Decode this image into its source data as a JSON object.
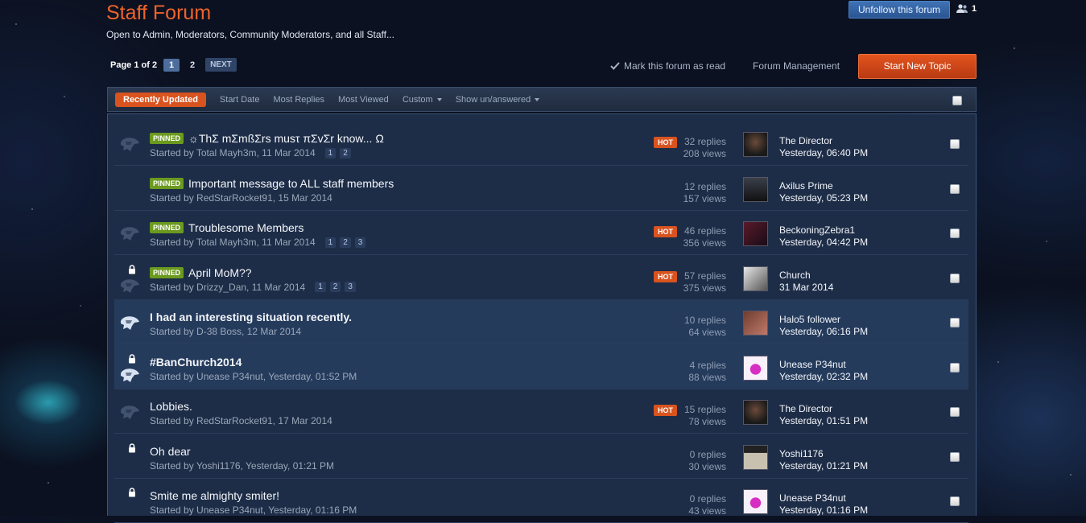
{
  "header": {
    "title": "Staff Forum",
    "subtitle": "Open to Admin, Moderators, Community Moderators, and all Staff...",
    "unfollow_label": "Unfollow this forum",
    "followers_count": "1"
  },
  "pagination": {
    "page_info": "Page 1 of 2",
    "pages": [
      "1",
      "2"
    ],
    "next_label": "NEXT"
  },
  "actions": {
    "mark_read": "Mark this forum as read",
    "forum_management": "Forum Management",
    "start_topic": "Start New Topic"
  },
  "filters": {
    "active": "Recently Updated",
    "items": [
      "Start Date",
      "Most Replies",
      "Most Viewed",
      "Custom",
      "Show un/answered"
    ]
  },
  "badges": {
    "pinned": "PINNED",
    "hot": "HOT"
  },
  "topics": [
    {
      "pinned": true,
      "hot": true,
      "title": "☼ThΣ mΣmßΣrs musτ πΣvΣr know... Ω",
      "started": "Started by Total Mayh3m, 11 Mar 2014",
      "pages": [
        "1",
        "2"
      ],
      "replies": "32 replies",
      "views": "208 views",
      "last_user": "The Director",
      "last_date": "Yesterday, 06:40 PM"
    },
    {
      "pinned": true,
      "hot": false,
      "title": "Important message to ALL staff members",
      "started": "Started by RedStarRocket91, 15 Mar 2014",
      "pages": [],
      "replies": "12 replies",
      "views": "157 views",
      "last_user": "Axilus Prime",
      "last_date": "Yesterday, 05:23 PM"
    },
    {
      "pinned": true,
      "hot": true,
      "title": "Troublesome Members",
      "started": "Started by Total Mayh3m, 11 Mar 2014",
      "pages": [
        "1",
        "2",
        "3"
      ],
      "replies": "46 replies",
      "views": "356 views",
      "last_user": "BeckoningZebra1",
      "last_date": "Yesterday, 04:42 PM"
    },
    {
      "pinned": true,
      "hot": true,
      "locked": true,
      "title": "April MoM??",
      "started": "Started by Drizzy_Dan, 11 Mar 2014",
      "pages": [
        "1",
        "2",
        "3"
      ],
      "replies": "57 replies",
      "views": "375 views",
      "last_user": "Church",
      "last_date": "31 Mar 2014"
    },
    {
      "pinned": false,
      "hot": false,
      "unread": true,
      "title": "I had an interesting situation recently.",
      "started": "Started by D-38 Boss, 12 Mar 2014",
      "pages": [],
      "replies": "10 replies",
      "views": "64 views",
      "last_user": "Halo5 follower",
      "last_date": "Yesterday, 06:16 PM"
    },
    {
      "pinned": false,
      "hot": false,
      "unread": true,
      "locked": true,
      "title": "#BanChurch2014",
      "started": "Started by Unease P34nut, Yesterday, 01:52 PM",
      "pages": [],
      "replies": "4 replies",
      "views": "88 views",
      "last_user": "Unease P34nut",
      "last_date": "Yesterday, 02:32 PM"
    },
    {
      "pinned": false,
      "hot": true,
      "title": "Lobbies.",
      "started": "Started by RedStarRocket91, 17 Mar 2014",
      "pages": [],
      "replies": "15 replies",
      "views": "78 views",
      "last_user": "The Director",
      "last_date": "Yesterday, 01:51 PM"
    },
    {
      "pinned": false,
      "hot": false,
      "locked": true,
      "title": "Oh dear",
      "started": "Started by Yoshi1176, Yesterday, 01:21 PM",
      "pages": [],
      "replies": "0 replies",
      "views": "30 views",
      "last_user": "Yoshi1176",
      "last_date": "Yesterday, 01:21 PM"
    },
    {
      "pinned": false,
      "hot": false,
      "locked": true,
      "title": "Smite me almighty smiter!",
      "started": "Started by Unease P34nut, Yesterday, 01:16 PM",
      "pages": [],
      "replies": "0 replies",
      "views": "43 views",
      "last_user": "Unease P34nut",
      "last_date": "Yesterday, 01:16 PM"
    }
  ],
  "colors": {
    "accent": "#f0632c",
    "button_orange": "#d9531f",
    "pinned_green": "#6b9a1e",
    "follow_blue": "#3f72b5",
    "row_bg": "#1e2d47"
  },
  "icons": [
    "followers-icon",
    "checkmark-icon",
    "status-helmet-icon",
    "lock-icon",
    "caret-down-icon"
  ]
}
